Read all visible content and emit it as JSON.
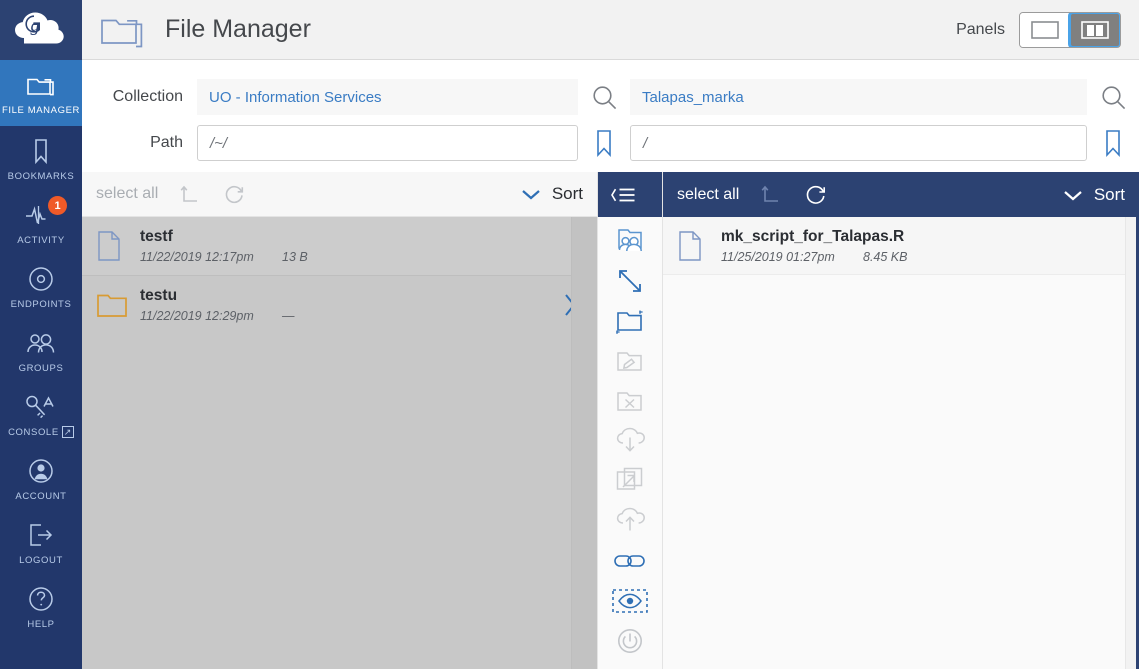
{
  "brand": {
    "logo_letter": "g",
    "accent": "#3176bd",
    "navy": "#2c4272",
    "rail": "#22376b"
  },
  "header": {
    "title": "File Manager",
    "folder_icon": "folder-icon",
    "panels_label": "Panels",
    "panel_single_icon": "single-panel-icon",
    "panel_dual_icon": "dual-panel-icon",
    "panel_selected": "dual"
  },
  "sidebar": {
    "items": [
      {
        "label": "FILE MANAGER",
        "icon": "folder-icon",
        "active": true,
        "badge": null
      },
      {
        "label": "BOOKMARKS",
        "icon": "bookmark-icon",
        "active": false,
        "badge": null
      },
      {
        "label": "ACTIVITY",
        "icon": "activity-pulse-icon",
        "active": false,
        "badge": "1"
      },
      {
        "label": "ENDPOINTS",
        "icon": "endpoint-disc-icon",
        "active": false,
        "badge": null
      },
      {
        "label": "GROUPS",
        "icon": "groups-people-icon",
        "active": false,
        "badge": null
      },
      {
        "label": "CONSOLE",
        "icon": "console-key-icon",
        "active": false,
        "badge": null,
        "external": "↗"
      },
      {
        "label": "ACCOUNT",
        "icon": "account-person-icon",
        "active": false,
        "badge": null
      },
      {
        "label": "LOGOUT",
        "icon": "logout-arrow-icon",
        "active": false,
        "badge": null
      },
      {
        "label": "HELP",
        "icon": "help-question-icon",
        "active": false,
        "badge": null
      }
    ]
  },
  "left_location": {
    "collection_label": "Collection",
    "collection_value": "UO - Information Services",
    "search_icon": "search-icon",
    "path_label": "Path",
    "path_value": "/~/",
    "bookmark_icon": "bookmark-icon"
  },
  "right_location": {
    "collection_value": "Talapas_marka",
    "search_icon": "search-icon",
    "path_value": "/",
    "bookmark_icon": "bookmark-icon"
  },
  "left_panel": {
    "toolbar": {
      "select_all": "select all",
      "up_icon": "up-directory-icon",
      "refresh_icon": "refresh-icon",
      "sort_label": "Sort",
      "sort_chevron_icon": "chevron-down-icon"
    },
    "files": [
      {
        "name": "testf",
        "date": "11/22/2019 12:17pm",
        "size": "13 B",
        "type": "file",
        "icon": "file-icon",
        "has_chevron": false,
        "chevron_icon": null
      },
      {
        "name": "testu",
        "date": "11/22/2019 12:29pm",
        "size": "—",
        "type": "folder",
        "icon": "folder-icon",
        "has_chevron": true,
        "chevron_icon": "chevron-right-icon"
      }
    ]
  },
  "right_panel": {
    "toolbar": {
      "collapse_icon": "collapse-list-icon",
      "select_all": "select all",
      "up_icon": "up-directory-icon",
      "refresh_icon": "refresh-icon",
      "sort_label": "Sort",
      "sort_chevron_icon": "chevron-down-icon"
    },
    "files": [
      {
        "name": "mk_script_for_Talapas.R",
        "date": "11/25/2019 01:27pm",
        "size": "8.45 KB",
        "type": "file",
        "icon": "file-icon",
        "has_chevron": false,
        "chevron_icon": null
      }
    ]
  },
  "tool_strip": {
    "header_icon": "collapse-list-icon",
    "tools": [
      {
        "icon": "share-folder-icon",
        "enabled": true
      },
      {
        "icon": "transfer-arrows-icon",
        "enabled": true
      },
      {
        "icon": "new-folder-icon",
        "enabled": true
      },
      {
        "icon": "rename-folder-icon",
        "enabled": false
      },
      {
        "icon": "delete-folder-icon",
        "enabled": false
      },
      {
        "icon": "download-cloud-icon",
        "enabled": false
      },
      {
        "icon": "open-external-icon",
        "enabled": false
      },
      {
        "icon": "upload-cloud-icon",
        "enabled": false
      },
      {
        "icon": "link-chain-icon",
        "enabled": true
      },
      {
        "icon": "preview-eye-icon",
        "enabled": true
      },
      {
        "icon": "power-icon",
        "enabled": false
      }
    ]
  }
}
